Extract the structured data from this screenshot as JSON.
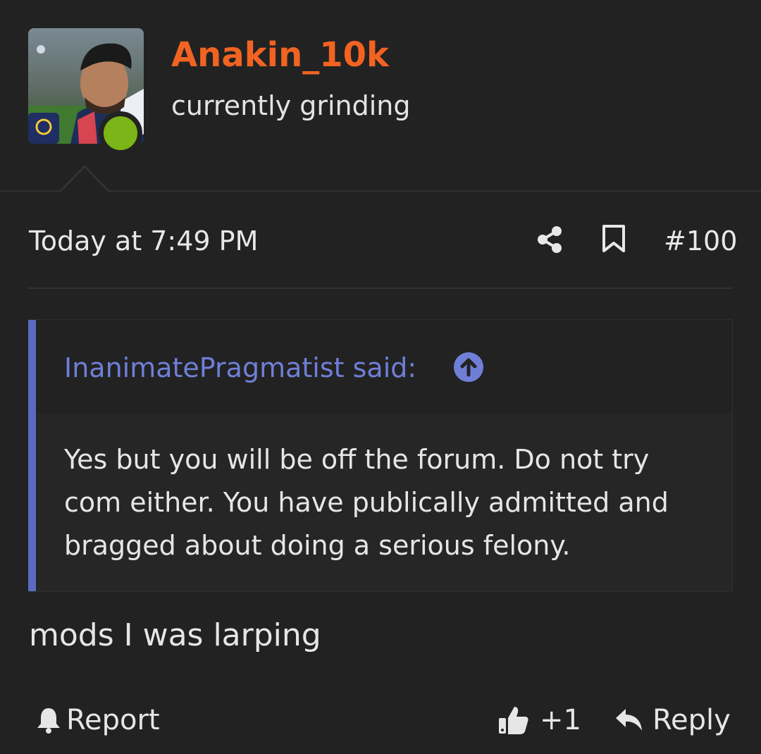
{
  "user": {
    "name": "Anakin_10k",
    "title": "currently grinding",
    "avatar_icon": "user-photo",
    "status": "online",
    "status_color": "#7cb518",
    "name_color": "#f26322"
  },
  "post_meta": {
    "date": "Today at 7:49 PM",
    "post_number": "#100",
    "share_icon": "share-icon",
    "bookmark_icon": "bookmark-icon"
  },
  "quote": {
    "author_line": "InanimatePragmatist said:",
    "jump_icon": "arrow-up-circle-icon",
    "text": "Yes but you will be off the forum. Do not try com either. You have publically admitted and bragged about doing a serious felony.",
    "accent_color": "#5b6bc0"
  },
  "post": {
    "text": "mods I was larping"
  },
  "actions": {
    "report_label": "Report",
    "like_count": "+1",
    "reply_label": "Reply"
  }
}
